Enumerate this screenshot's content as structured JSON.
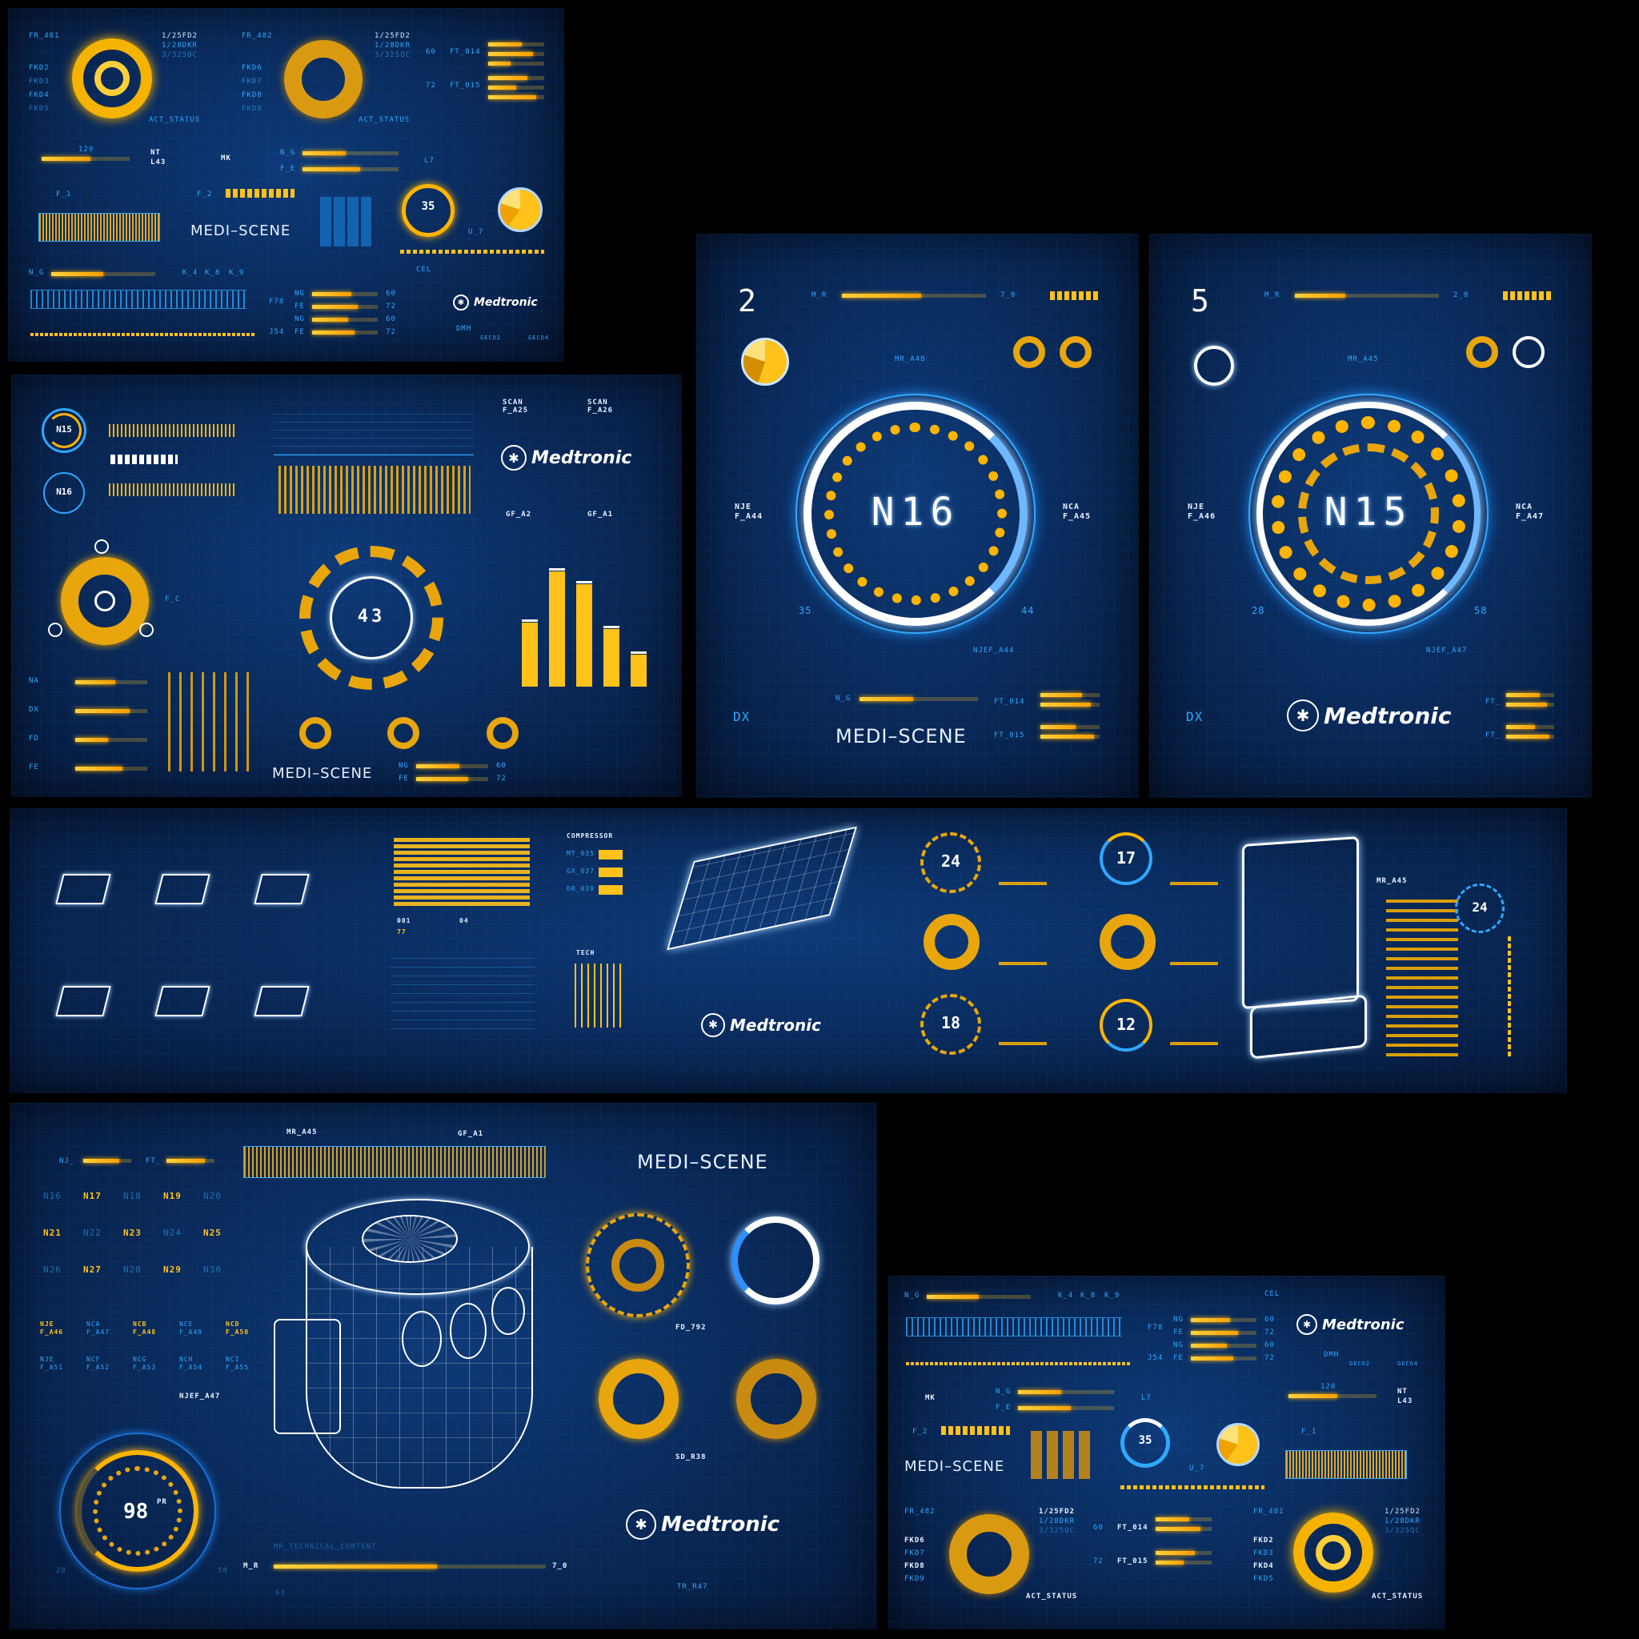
{
  "brand": {
    "logo_text": "Medtronic",
    "scene_title": "MEDI–SCENE"
  },
  "colors": {
    "background": "#0a2c5e",
    "accent_yellow": "#ffc21a",
    "accent_blue": "#2fa8ff",
    "white": "#ffffff"
  },
  "panel1": {
    "fr1": "FR_481",
    "fr2": "FR_482",
    "codes": [
      "1/25FD2",
      "1/28DKR",
      "3/325QC"
    ],
    "fkd_left": [
      "FKD2",
      "FKD3",
      "FKD4",
      "FKD5"
    ],
    "fkd_right": [
      "FKD6",
      "FKD7",
      "FKD8",
      "FKD9"
    ],
    "act_status": "ACT_STATUS",
    "ft1": "FT_014",
    "ft2": "FT_015",
    "n60": "60",
    "n72": "72",
    "slider_value": "120",
    "nt": "NT",
    "l43": "L43",
    "mk": "MK",
    "ng": "N_G",
    "fe": "F_E",
    "f1": "F_1",
    "f2": "F_2",
    "l7": "L7",
    "gauge_value": "35",
    "u7": "U_7",
    "k4": "K_4",
    "k8": "K_8",
    "k9": "K_9",
    "cel": "CEL",
    "f78": "F78",
    "j54": "J54",
    "rows": [
      {
        "k": "NG",
        "v": "60"
      },
      {
        "k": "FE",
        "v": "72"
      },
      {
        "k": "NG",
        "v": "60"
      },
      {
        "k": "FE",
        "v": "72"
      }
    ],
    "dmh": "DMH",
    "geco": [
      "GECO1",
      "GECO2",
      "GECO3",
      "GECO4"
    ]
  },
  "panel2": {
    "n15": "N15",
    "n16": "N16",
    "dial": "43",
    "scan1": "SCAN",
    "scan1b": "F_A25",
    "scan2": "SCAN",
    "scan2b": "F_A26",
    "gf_a2": "GF_A2",
    "gf_a1": "GF_A1",
    "fc": "F_C",
    "ng": "NG",
    "fe": "FE",
    "v60": "60",
    "v72": "72",
    "bars_values": [
      0.5,
      0.9,
      0.8,
      0.45,
      0.25
    ],
    "side_labels": [
      "NA",
      "DX",
      "FD",
      "FE"
    ]
  },
  "panel3": {
    "index": "2",
    "mr": "M_R",
    "v70": "7_0",
    "mra": "MR_A48",
    "center": "N16",
    "left_a": "NJE",
    "left_b": "F_A44",
    "right_a": "NCA",
    "right_b": "F_A45",
    "low": "35",
    "high": "44",
    "njef": "NJEF_A44",
    "dx": "DX",
    "ng": "N_G",
    "ft1": "FT_014",
    "ft2": "FT_015",
    "progress": 0.55
  },
  "panel4": {
    "index": "5",
    "mr": "M_R",
    "v20": "2_0",
    "mra": "MR_A45",
    "center": "N15",
    "left_a": "NJE",
    "left_b": "F_A46",
    "right_a": "NCA",
    "right_b": "F_A47",
    "low": "28",
    "high": "58",
    "njef": "NJEF_A47",
    "dx": "DX",
    "ft": "FT_",
    "progress": 0.35
  },
  "panel5": {
    "compressor": "COMPRESSOR",
    "tech": "TECH",
    "comp_rows": [
      "MT_035",
      "GX_037",
      "DR_039"
    ],
    "dials": [
      "24",
      "17",
      "18",
      "12"
    ],
    "dial_side": "24",
    "mra": "MR_A45",
    "v001": "001",
    "v04": "04",
    "v77": "77"
  },
  "panel6": {
    "mra": "MR_A45",
    "gfa": "GF_A1",
    "nj": "NJ_",
    "ft": "FT_",
    "grid_row1": [
      "N16",
      "N17",
      "N18",
      "N19",
      "N20"
    ],
    "grid_row2": [
      "N21",
      "N22",
      "N23",
      "N24",
      "N25"
    ],
    "grid_row3": [
      "N26",
      "N27",
      "N28",
      "N29",
      "N30"
    ],
    "pairs1": [
      [
        "NJE",
        "F_A46"
      ],
      [
        "NCA",
        "F_A47"
      ],
      [
        "NCB",
        "F_A48"
      ],
      [
        "NCE",
        "F_A49"
      ],
      [
        "NCD",
        "F_A50"
      ]
    ],
    "pairs2": [
      [
        "NJE",
        "F_A51"
      ],
      [
        "NCF",
        "F_A52"
      ],
      [
        "NCG",
        "F_A53"
      ],
      [
        "NCH",
        "F_A54"
      ],
      [
        "NCI",
        "F_A55"
      ]
    ],
    "njef": "NJEF_A47",
    "gauge": "98",
    "gauge_unit": "PR",
    "low": "28",
    "high": "58",
    "tech_content": "MR_TECHNICAL_CONTENT",
    "mr": "M_R",
    "v70": "7_0",
    "v63": "63",
    "fd": "FD_792",
    "sd": "SD_R38",
    "tr": "TR_R47"
  },
  "panel7": {
    "ng": "N_G",
    "k4": "K_4",
    "k8": "K_8",
    "k9": "K_9",
    "cel": "CEL",
    "f78": "F78",
    "j54": "J54",
    "mk": "MK",
    "fe": "F_E",
    "l7": "L7",
    "slider": "120",
    "nt": "NT",
    "l43": "L43",
    "f2": "F_2",
    "f1": "F_1",
    "gauge": "35",
    "u7": "U_7",
    "fr1": "FR_482",
    "fr2": "FR_481",
    "codes": [
      "1/25FD2",
      "1/28DKR",
      "3/325QC"
    ],
    "fkd_left": [
      "FKD6",
      "FKD7",
      "FKD8",
      "FKD9"
    ],
    "fkd_right": [
      "FKD2",
      "FKD3",
      "FKD4",
      "FKD5"
    ],
    "ft1": "FT_014",
    "ft2": "FT_015",
    "n60": "60",
    "n72": "72",
    "act_status": "ACT_STATUS",
    "rows": [
      {
        "k": "NG",
        "v": "60"
      },
      {
        "k": "FE",
        "v": "72"
      },
      {
        "k": "NG",
        "v": "60"
      },
      {
        "k": "FE",
        "v": "72"
      }
    ],
    "dmh": "DMH",
    "geco": [
      "GECO1",
      "GECO2",
      "GECO3",
      "GECO4"
    ]
  }
}
